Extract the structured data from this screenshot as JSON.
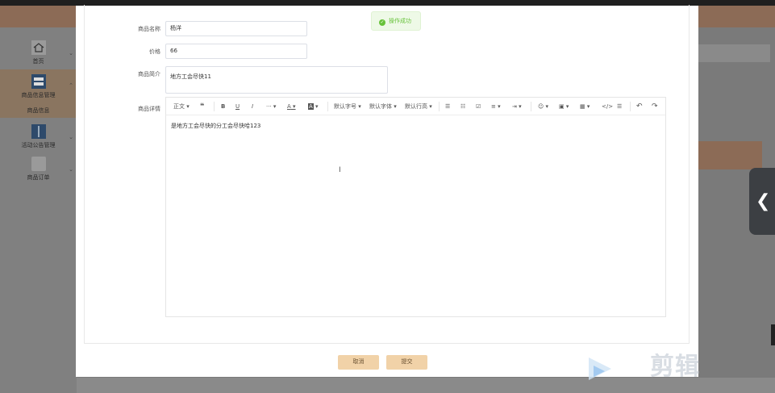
{
  "sidebar": {
    "items": [
      {
        "label": "首页"
      },
      {
        "label": "商品信息管理"
      },
      {
        "label": "商品信息"
      },
      {
        "label": "活动公告管理"
      },
      {
        "label": "商品订单"
      }
    ]
  },
  "toast": {
    "message": "操作成功"
  },
  "form": {
    "name_label": "商品名称",
    "name_value": "杨洋",
    "price_label": "价格",
    "price_value": "66",
    "intro_label": "商品简介",
    "intro_value": "地方工会尽快11",
    "detail_label": "商品详情"
  },
  "editor": {
    "toolbar": {
      "paragraph": "正文",
      "quote": "❝",
      "bold": "B",
      "underline": "U",
      "italic": "I",
      "more": "···",
      "font_color": "A",
      "bg_color": "A",
      "font_size": "默认字号",
      "font_family": "默认字体",
      "line_height": "默认行高",
      "undo": "↶",
      "redo": "↷"
    },
    "content": "是地方工会尽快的分工会尽快哈123"
  },
  "buttons": {
    "cancel": "取消",
    "submit": "提交"
  },
  "watermark": {
    "text": "剪辑"
  },
  "colors": {
    "primary_button": "#f1d2a8",
    "header": "#8c6b56",
    "success": "#67c23a"
  }
}
